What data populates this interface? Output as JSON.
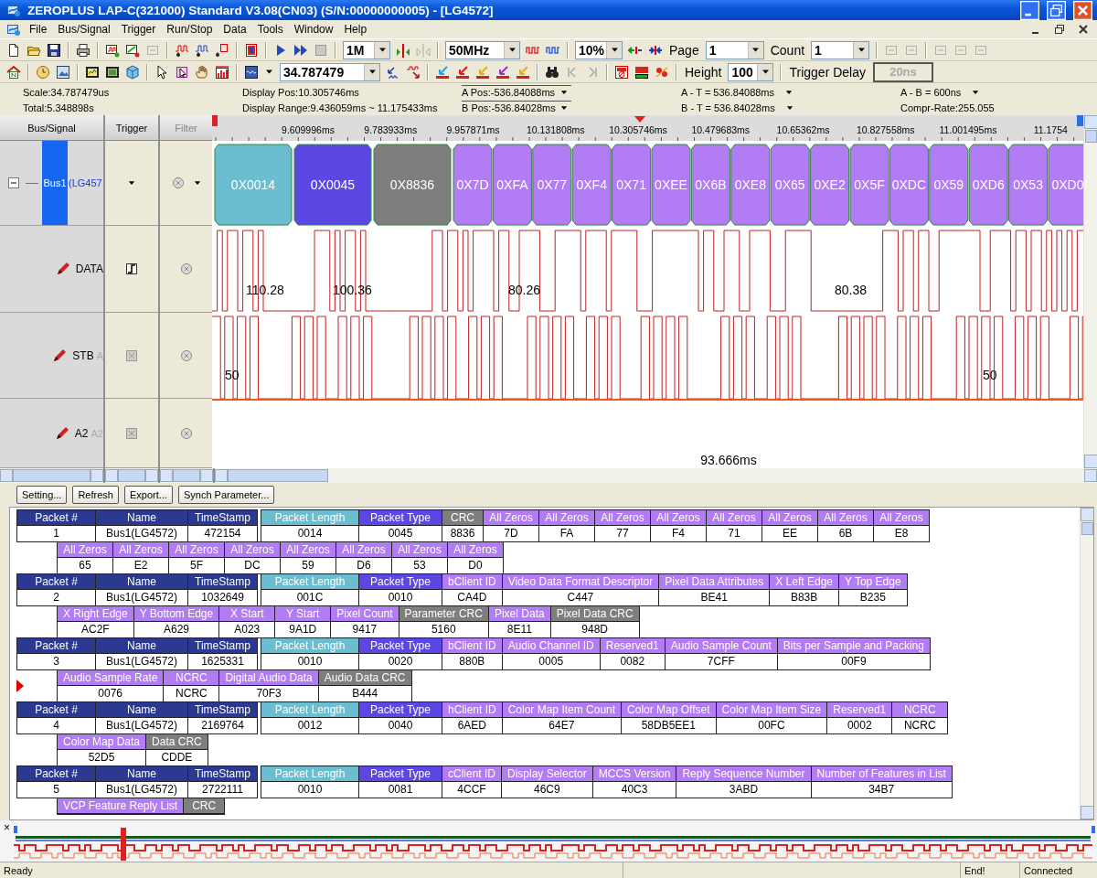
{
  "window": {
    "title": "ZEROPLUS LAP-C(321000) Standard V3.08(CN03) (S/N:00000000005) - [LG4572]"
  },
  "menu": [
    "File",
    "Bus/Signal",
    "Trigger",
    "Run/Stop",
    "Data",
    "Tools",
    "Window",
    "Help"
  ],
  "toolbar": {
    "depth": "1M",
    "clock": "50MHz",
    "zoom": "10%",
    "page": {
      "label": "Page",
      "value": "1"
    },
    "count": {
      "label": "Count",
      "value": "1"
    },
    "scale": "34.787479",
    "height": {
      "label": "Height",
      "value": "100"
    },
    "trigger_delay": {
      "label": "Trigger Delay",
      "value": "20ns",
      "disabled": true
    }
  },
  "info": {
    "scale": "Scale:34.787479us",
    "total": "Total:5.348898s",
    "display_pos": "Display Pos:10.305746ms",
    "display_range": "Display Range:9.436059ms ~ 11.175433ms",
    "a_pos": "A Pos:-536.84088ms",
    "b_pos": "B Pos:-536.84028ms",
    "a_t": "A - T = 536.84088ms",
    "b_t": "B - T = 536.84028ms",
    "a_b": "A - B = 600ns",
    "compr_rate": "Compr-Rate:255.055"
  },
  "signals": {
    "headers": [
      "Bus/Signal",
      "Trigger",
      "Filter"
    ],
    "rows": [
      {
        "kind": "bus",
        "name": "Bus1",
        "alias": "(LG457",
        "expanded": true
      },
      {
        "kind": "signal",
        "name": "DATA",
        "edge_trigger": true
      },
      {
        "kind": "signal",
        "name": "STB",
        "alias": "A",
        "edge_trigger": false
      },
      {
        "kind": "signal",
        "name": "A2",
        "alias": "A2",
        "edge_trigger": false
      }
    ]
  },
  "waveform": {
    "ticks": [
      "9.609996ms",
      "9.783933ms",
      "9.957871ms",
      "10.131808ms",
      "10.305746ms",
      "10.479683ms",
      "10.65362ms",
      "10.827558ms",
      "11.001495ms",
      "11.1754"
    ],
    "bus_values": [
      {
        "label": "0X0014",
        "kind": "length"
      },
      {
        "label": "0X0045",
        "kind": "type"
      },
      {
        "label": "0X8836",
        "kind": "crc"
      },
      {
        "label": "0X7D",
        "kind": "field"
      },
      {
        "label": "0XFA",
        "kind": "field"
      },
      {
        "label": "0X77",
        "kind": "field"
      },
      {
        "label": "0XF4",
        "kind": "field"
      },
      {
        "label": "0X71",
        "kind": "field"
      },
      {
        "label": "0XEE",
        "kind": "field"
      },
      {
        "label": "0X6B",
        "kind": "field"
      },
      {
        "label": "0XE8",
        "kind": "field"
      },
      {
        "label": "0X65",
        "kind": "field"
      },
      {
        "label": "0XE2",
        "kind": "field"
      },
      {
        "label": "0X5F",
        "kind": "field"
      },
      {
        "label": "0XDC",
        "kind": "field"
      },
      {
        "label": "0X59",
        "kind": "field"
      },
      {
        "label": "0XD6",
        "kind": "field"
      },
      {
        "label": "0X53",
        "kind": "field"
      },
      {
        "label": "0XD0",
        "kind": "field"
      }
    ],
    "data_labels": [
      "110.28",
      "100.36",
      "80.26",
      "80.38"
    ],
    "stb_labels": [
      "50",
      "50"
    ],
    "cursor_readout": "93.666ms"
  },
  "buttons": [
    "Setting...",
    "Refresh",
    "Export...",
    "Synch Parameter..."
  ],
  "packets": [
    {
      "selected": false,
      "meta": [
        {
          "header": "Packet #",
          "value": "1"
        },
        {
          "header": "Name",
          "value": "Bus1(LG4572)"
        },
        {
          "header": "TimeStamp",
          "value": "472154"
        }
      ],
      "lines": [
        [
          {
            "kind": "length",
            "header": "Packet Length",
            "value": "0014"
          },
          {
            "kind": "type",
            "header": "Packet Type",
            "value": "0045"
          },
          {
            "kind": "crc",
            "header": "CRC",
            "value": "8836"
          },
          {
            "kind": "field",
            "header": "All Zeros",
            "value": "7D"
          },
          {
            "kind": "field",
            "header": "All Zeros",
            "value": "FA"
          },
          {
            "kind": "field",
            "header": "All Zeros",
            "value": "77"
          },
          {
            "kind": "field",
            "header": "All Zeros",
            "value": "F4"
          },
          {
            "kind": "field",
            "header": "All Zeros",
            "value": "71"
          },
          {
            "kind": "field",
            "header": "All Zeros",
            "value": "EE"
          },
          {
            "kind": "field",
            "header": "All Zeros",
            "value": "6B"
          },
          {
            "kind": "field",
            "header": "All Zeros",
            "value": "E8"
          }
        ],
        [
          {
            "kind": "field",
            "header": "All Zeros",
            "value": "65"
          },
          {
            "kind": "field",
            "header": "All Zeros",
            "value": "E2"
          },
          {
            "kind": "field",
            "header": "All Zeros",
            "value": "5F"
          },
          {
            "kind": "field",
            "header": "All Zeros",
            "value": "DC"
          },
          {
            "kind": "field",
            "header": "All Zeros",
            "value": "59"
          },
          {
            "kind": "field",
            "header": "All Zeros",
            "value": "D6"
          },
          {
            "kind": "field",
            "header": "All Zeros",
            "value": "53"
          },
          {
            "kind": "field",
            "header": "All Zeros",
            "value": "D0"
          }
        ]
      ]
    },
    {
      "selected": false,
      "meta": [
        {
          "header": "Packet #",
          "value": "2"
        },
        {
          "header": "Name",
          "value": "Bus1(LG4572)"
        },
        {
          "header": "TimeStamp",
          "value": "1032649"
        }
      ],
      "lines": [
        [
          {
            "kind": "length",
            "header": "Packet Length",
            "value": "001C"
          },
          {
            "kind": "type",
            "header": "Packet Type",
            "value": "0010"
          },
          {
            "kind": "field",
            "header": "bClient ID",
            "value": "CA4D"
          },
          {
            "kind": "field",
            "header": "Video Data Format Descriptor",
            "value": "C447"
          },
          {
            "kind": "field",
            "header": "Pixel Data Attributes",
            "value": "BE41"
          },
          {
            "kind": "field",
            "header": "X Left Edge",
            "value": "B83B"
          },
          {
            "kind": "field",
            "header": "Y Top Edge",
            "value": "B235"
          }
        ],
        [
          {
            "kind": "field",
            "header": "X Right Edge",
            "value": "AC2F"
          },
          {
            "kind": "field",
            "header": "Y Bottom Edge",
            "value": "A629"
          },
          {
            "kind": "field",
            "header": "X Start",
            "value": "A023"
          },
          {
            "kind": "field",
            "header": "Y Start",
            "value": "9A1D"
          },
          {
            "kind": "field",
            "header": "Pixel Count",
            "value": "9417"
          },
          {
            "kind": "crc",
            "header": "Parameter CRC",
            "value": "5160"
          },
          {
            "kind": "field",
            "header": "Pixel Data",
            "value": "8E11"
          },
          {
            "kind": "crc",
            "header": "Pixel Data CRC",
            "value": "948D"
          }
        ]
      ]
    },
    {
      "selected": true,
      "meta": [
        {
          "header": "Packet #",
          "value": "3"
        },
        {
          "header": "Name",
          "value": "Bus1(LG4572)"
        },
        {
          "header": "TimeStamp",
          "value": "1625331"
        }
      ],
      "lines": [
        [
          {
            "kind": "length",
            "header": "Packet Length",
            "value": "0010"
          },
          {
            "kind": "type",
            "header": "Packet Type",
            "value": "0020"
          },
          {
            "kind": "field",
            "header": "bClient ID",
            "value": "880B"
          },
          {
            "kind": "field",
            "header": "Audio Channel ID",
            "value": "0005"
          },
          {
            "kind": "field",
            "header": "Reserved1",
            "value": "0082"
          },
          {
            "kind": "field",
            "header": "Audio Sample Count",
            "value": "7CFF"
          },
          {
            "kind": "field",
            "header": "Bits per Sample and Packing",
            "value": "00F9"
          }
        ],
        [
          {
            "kind": "field",
            "header": "Audio Sample Rate",
            "value": "0076"
          },
          {
            "kind": "field",
            "header": "NCRC",
            "value": "NCRC"
          },
          {
            "kind": "field",
            "header": "Digital Audio Data",
            "value": "70F3"
          },
          {
            "kind": "crc",
            "header": "Audio Data CRC",
            "value": "B444"
          }
        ]
      ]
    },
    {
      "selected": false,
      "meta": [
        {
          "header": "Packet #",
          "value": "4"
        },
        {
          "header": "Name",
          "value": "Bus1(LG4572)"
        },
        {
          "header": "TimeStamp",
          "value": "2169764"
        }
      ],
      "lines": [
        [
          {
            "kind": "length",
            "header": "Packet Length",
            "value": "0012"
          },
          {
            "kind": "type",
            "header": "Packet Type",
            "value": "0040"
          },
          {
            "kind": "field",
            "header": "hClient ID",
            "value": "6AED"
          },
          {
            "kind": "field",
            "header": "Color Map Item Count",
            "value": "64E7"
          },
          {
            "kind": "field",
            "header": "Color Map Offset",
            "value": "58DB5EE1"
          },
          {
            "kind": "field",
            "header": "Color Map Item Size",
            "value": "00FC"
          },
          {
            "kind": "field",
            "header": "Reserved1",
            "value": "0002"
          },
          {
            "kind": "field",
            "header": "NCRC",
            "value": "NCRC"
          }
        ],
        [
          {
            "kind": "field",
            "header": "Color Map Data",
            "value": "52D5"
          },
          {
            "kind": "crc",
            "header": "Data CRC",
            "value": "CDDE"
          }
        ]
      ]
    },
    {
      "selected": false,
      "meta": [
        {
          "header": "Packet #",
          "value": "5"
        },
        {
          "header": "Name",
          "value": "Bus1(LG4572)"
        },
        {
          "header": "TimeStamp",
          "value": "2722111"
        }
      ],
      "lines": [
        [
          {
            "kind": "length",
            "header": "Packet Length",
            "value": "0010"
          },
          {
            "kind": "type",
            "header": "Packet Type",
            "value": "0081"
          },
          {
            "kind": "field",
            "header": "cClient ID",
            "value": "4CCF"
          },
          {
            "kind": "field",
            "header": "Display Selector",
            "value": "46C9"
          },
          {
            "kind": "field",
            "header": "MCCS Version",
            "value": "40C3"
          },
          {
            "kind": "field",
            "header": "Reply Sequence Number",
            "value": "3ABD"
          },
          {
            "kind": "field",
            "header": "Number of Features in List",
            "value": "34B7"
          }
        ],
        [
          {
            "kind": "field",
            "header": "VCP Feature Reply List"
          },
          {
            "kind": "crc",
            "header": "CRC"
          }
        ]
      ]
    }
  ],
  "overview": {
    "close": "×"
  },
  "status_bar": {
    "message": "Ready",
    "state": "End!",
    "connection": "Connected"
  }
}
